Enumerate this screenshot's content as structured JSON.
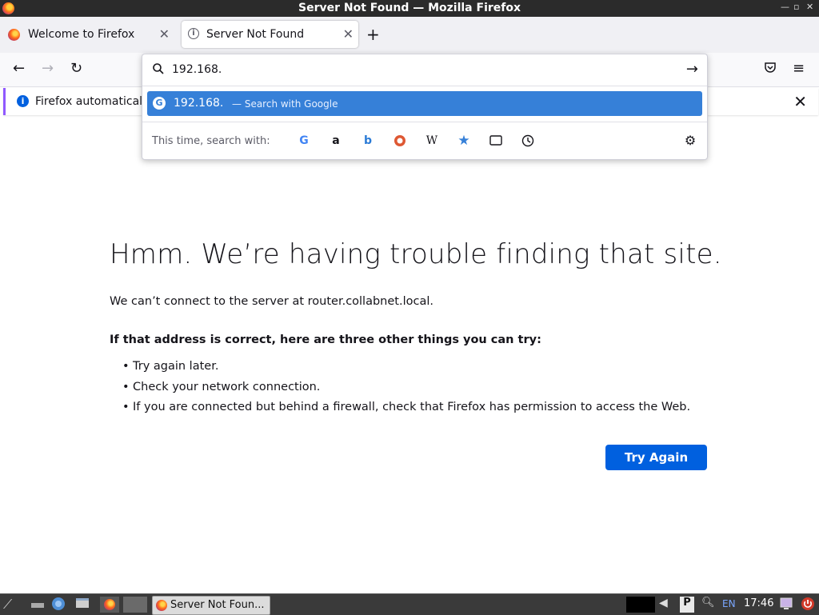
{
  "window": {
    "title": "Server Not Found — Mozilla Firefox"
  },
  "tabs": [
    {
      "label": "Welcome to Firefox",
      "active": false
    },
    {
      "label": "Server Not Found",
      "active": true
    }
  ],
  "infobar": {
    "message": "Firefox automaticall"
  },
  "urlbar": {
    "value": "192.168.",
    "result": {
      "query": "192.168.",
      "separator": "—",
      "action": "Search with Google"
    },
    "oneoff_label": "This time, search with:",
    "engines": [
      "google-icon",
      "amazon-icon",
      "bing-icon",
      "duckduckgo-icon",
      "wikipedia-icon",
      "bookmarks-icon",
      "tabs-icon",
      "history-icon"
    ]
  },
  "page": {
    "heading": "Hmm. We’re having trouble finding that site.",
    "description": "We can’t connect to the server at router.collabnet.local.",
    "try_heading": "If that address is correct, here are three other things you can try:",
    "suggestions": [
      "Try again later.",
      "Check your network connection.",
      "If you are connected but behind a firewall, check that Firefox has permission to access the Web."
    ],
    "try_again_label": "Try Again"
  },
  "taskbar": {
    "task_label": "Server Not Foun...",
    "clock": "17:46",
    "lang": "EN"
  },
  "colors": {
    "accent": "#0060df",
    "highlight": "#3680d8",
    "infobar_border": "#9059ff"
  }
}
